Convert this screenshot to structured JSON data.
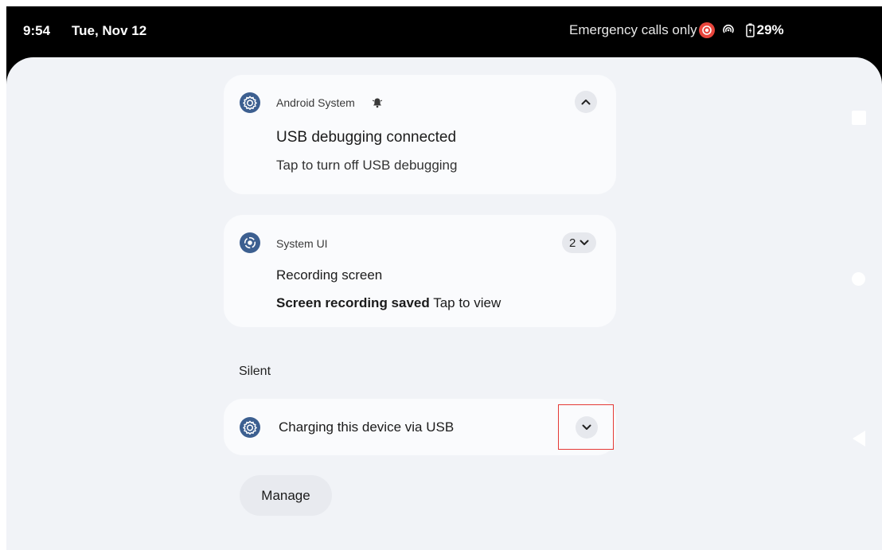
{
  "status_bar": {
    "time": "9:54",
    "date": "Tue, Nov 12",
    "network_status": "Emergency calls only",
    "battery": "29%",
    "icons": [
      "screen-record-icon",
      "hotspot-icon",
      "battery-charging-icon"
    ]
  },
  "notifications": [
    {
      "app": "Android System",
      "app_icon": "settings-gear-icon",
      "alert_icon": "bell-icon",
      "title": "USB debugging connected",
      "text": "Tap to turn off USB debugging",
      "expanded": true
    },
    {
      "app": "System UI",
      "app_icon": "screen-record-icon",
      "count": "2",
      "title": "Recording screen",
      "text_bold": "Screen recording saved",
      "text": "Tap to view"
    }
  ],
  "silent_section": {
    "label": "Silent",
    "items": [
      {
        "app_icon": "settings-gear-icon",
        "title": "Charging this device via USB",
        "expanded": false
      }
    ]
  },
  "manage_button": "Manage",
  "colors": {
    "status_bar_bg": "#000000",
    "shade_bg": "#f1f3f7",
    "card_bg": "#fafbfd",
    "app_icon_bg": "#3c5f90",
    "record_red": "#e8453c",
    "highlight_border": "#e53935"
  }
}
